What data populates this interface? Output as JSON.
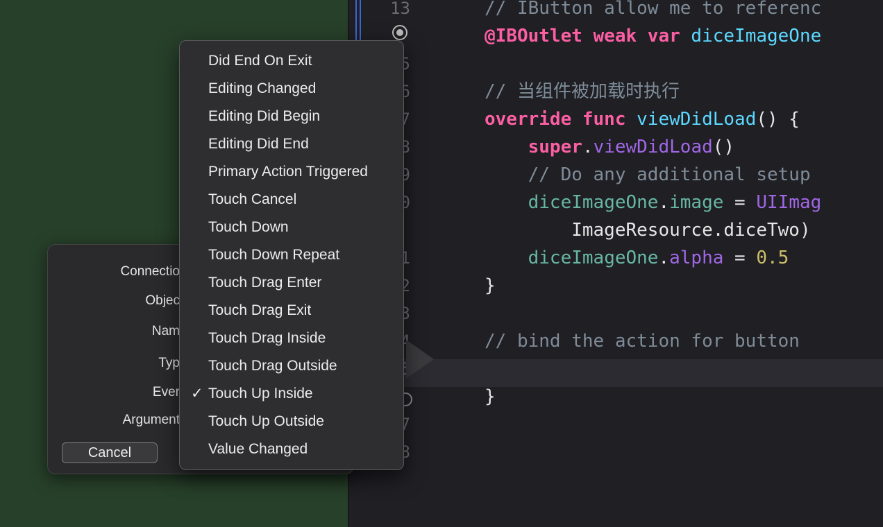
{
  "editor": {
    "lines": [
      {
        "num": "13",
        "tokens": [
          [
            "c-comment",
            "// IButton allow me to referenc"
          ]
        ]
      },
      {
        "num": "",
        "tokens": [
          [
            "c-kw",
            "@IBOutlet weak var "
          ],
          [
            "c-type",
            "diceImageOne"
          ]
        ]
      },
      {
        "num": "5",
        "tokens": []
      },
      {
        "num": "6",
        "tokens": [
          [
            "c-comment",
            "// 当组件被加载时执行"
          ]
        ]
      },
      {
        "num": "7",
        "tokens": [
          [
            "c-kw",
            "override func "
          ],
          [
            "c-type",
            "viewDidLoad"
          ],
          [
            "c-plain",
            "() {"
          ]
        ]
      },
      {
        "num": "8",
        "tokens": [
          [
            "c-plain",
            "    "
          ],
          [
            "c-kw",
            "super"
          ],
          [
            "c-plain",
            "."
          ],
          [
            "c-call",
            "viewDidLoad"
          ],
          [
            "c-plain",
            "()"
          ]
        ]
      },
      {
        "num": "9",
        "tokens": [
          [
            "c-comment",
            "    // Do any additional setup"
          ]
        ]
      },
      {
        "num": "0",
        "tokens": [
          [
            "c-plain",
            "    "
          ],
          [
            "c-fn",
            "diceImageOne"
          ],
          [
            "c-plain",
            "."
          ],
          [
            "c-fn",
            "image"
          ],
          [
            "c-plain",
            " = "
          ],
          [
            "c-call",
            "UIImag"
          ]
        ]
      },
      {
        "num": "",
        "tokens": [
          [
            "c-plain",
            "        ImageResource.diceTwo)"
          ]
        ]
      },
      {
        "num": "1",
        "tokens": [
          [
            "c-plain",
            "    "
          ],
          [
            "c-fn",
            "diceImageOne"
          ],
          [
            "c-plain",
            "."
          ],
          [
            "c-call",
            "alpha"
          ],
          [
            "c-plain",
            " = "
          ],
          [
            "c-num",
            "0.5"
          ]
        ]
      },
      {
        "num": "2",
        "tokens": [
          [
            "c-plain",
            "}"
          ]
        ]
      },
      {
        "num": "3",
        "tokens": []
      },
      {
        "num": "4",
        "tokens": [
          [
            "c-comment",
            "// bind the action for button"
          ]
        ]
      },
      {
        "num": "5",
        "tokens": []
      },
      {
        "num": "",
        "tokens": [
          [
            "c-plain",
            "}"
          ]
        ]
      },
      {
        "num": "7",
        "tokens": []
      },
      {
        "num": "8",
        "tokens": []
      }
    ]
  },
  "dialog": {
    "labels": {
      "connection": "Connectio",
      "object": "Objec",
      "name": "Nam",
      "type": "Typ",
      "event": "Ever",
      "arguments": "Argument"
    },
    "cancel_label": "Cancel"
  },
  "menu": {
    "items": [
      {
        "label": "Did End On Exit",
        "checked": false
      },
      {
        "label": "Editing Changed",
        "checked": false
      },
      {
        "label": "Editing Did Begin",
        "checked": false
      },
      {
        "label": "Editing Did End",
        "checked": false
      },
      {
        "label": "Primary Action Triggered",
        "checked": false
      },
      {
        "label": "Touch Cancel",
        "checked": false
      },
      {
        "label": "Touch Down",
        "checked": false
      },
      {
        "label": "Touch Down Repeat",
        "checked": false
      },
      {
        "label": "Touch Drag Enter",
        "checked": false
      },
      {
        "label": "Touch Drag Exit",
        "checked": false
      },
      {
        "label": "Touch Drag Inside",
        "checked": false
      },
      {
        "label": "Touch Drag Outside",
        "checked": false
      },
      {
        "label": "Touch Up Inside",
        "checked": true
      },
      {
        "label": "Touch Up Outside",
        "checked": false
      },
      {
        "label": "Value Changed",
        "checked": false
      }
    ],
    "check_glyph": "✓"
  }
}
